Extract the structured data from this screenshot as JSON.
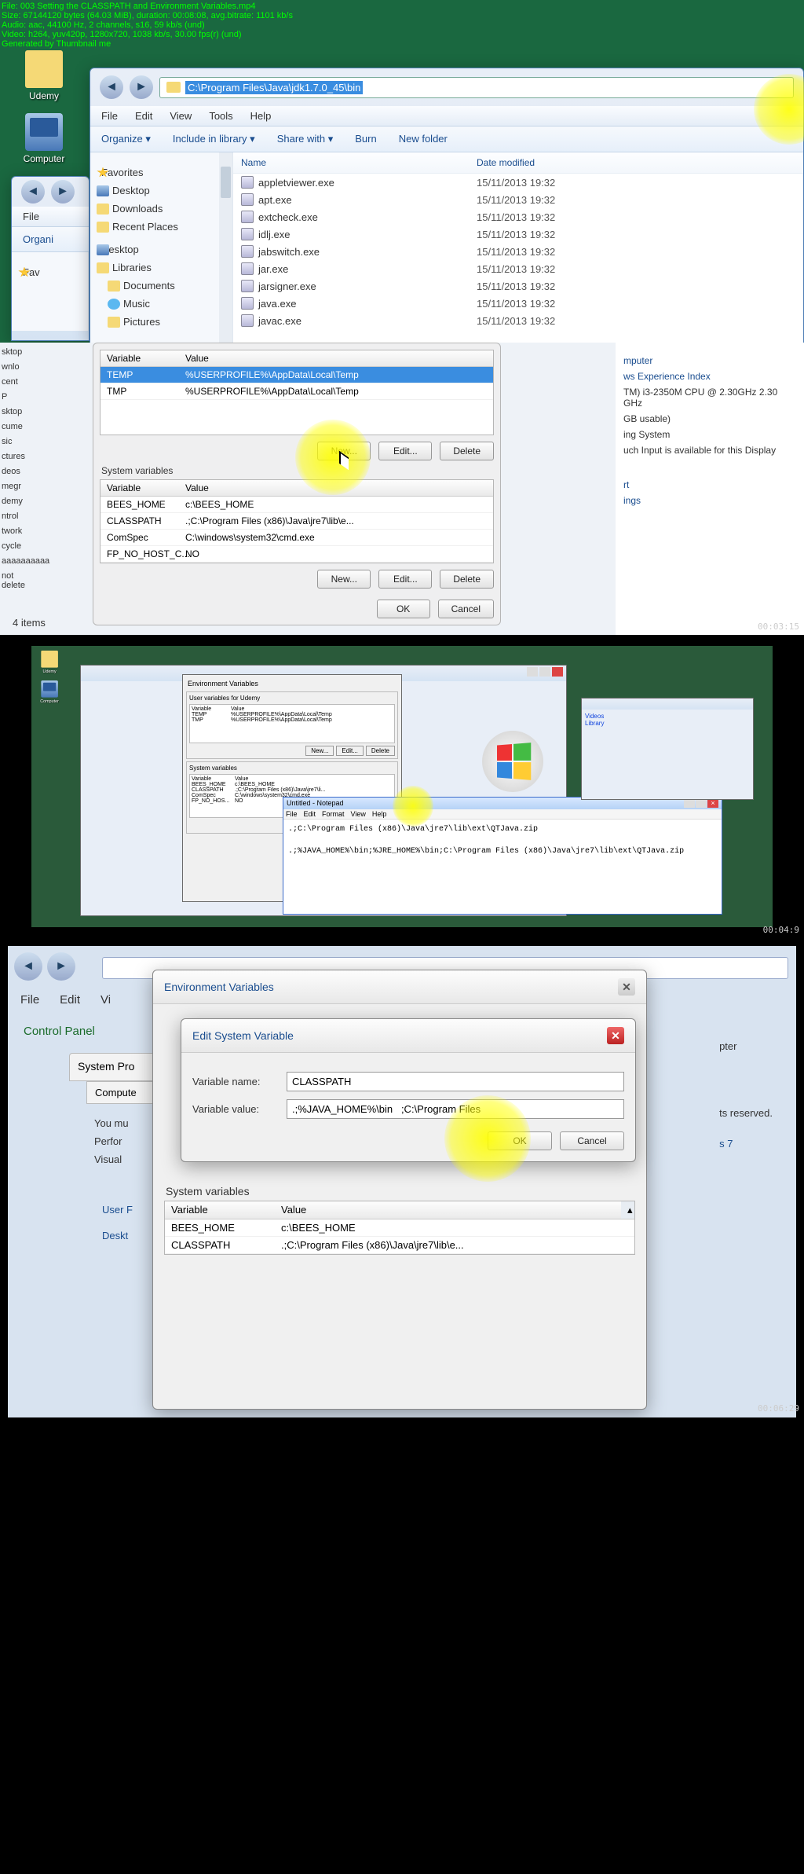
{
  "meta": {
    "l1": "File: 003 Setting the CLASSPATH and Environment Variables.mp4",
    "l2": "Size: 67144120 bytes (64.03 MiB), duration: 00:08:08, avg.bitrate: 1101 kb/s",
    "l3": "Audio: aac, 44100 Hz, 2 channels, s16, 59 kb/s (und)",
    "l4": "Video: h264, yuv420p, 1280x720, 1038 kb/s, 30.00 fps(r) (und)",
    "l5": "Generated by Thumbnail me"
  },
  "ts": {
    "s1": "00:03:15",
    "s2": "00:04:9",
    "s3": "00:06:29"
  },
  "desktop": {
    "udemy": "Udemy",
    "computer": "Computer"
  },
  "explorer": {
    "address": "C:\\Program Files\\Java\\jdk1.7.0_45\\bin",
    "menu": [
      "File",
      "Edit",
      "View",
      "Tools",
      "Help"
    ],
    "toolbar": [
      "Organize ▾",
      "Include in library ▾",
      "Share with ▾",
      "Burn",
      "New folder"
    ],
    "side": {
      "fav": "Favorites",
      "desk": "Desktop",
      "dl": "Downloads",
      "rp": "Recent Places",
      "desk2": "Desktop",
      "lib": "Libraries",
      "docs": "Documents",
      "mus": "Music",
      "pic": "Pictures"
    },
    "cols": {
      "name": "Name",
      "date": "Date modified"
    },
    "files": [
      {
        "n": "appletviewer.exe",
        "d": "15/11/2013 19:32"
      },
      {
        "n": "apt.exe",
        "d": "15/11/2013 19:32"
      },
      {
        "n": "extcheck.exe",
        "d": "15/11/2013 19:32"
      },
      {
        "n": "idlj.exe",
        "d": "15/11/2013 19:32"
      },
      {
        "n": "jabswitch.exe",
        "d": "15/11/2013 19:32"
      },
      {
        "n": "jar.exe",
        "d": "15/11/2013 19:32"
      },
      {
        "n": "jarsigner.exe",
        "d": "15/11/2013 19:32"
      },
      {
        "n": "java.exe",
        "d": "15/11/2013 19:32"
      },
      {
        "n": "javac.exe",
        "d": "15/11/2013 19:32"
      }
    ]
  },
  "s1side": [
    "sktop",
    "wnlo",
    "cent",
    "P",
    "sktop",
    "cume",
    "sic",
    "ctures",
    "deos",
    "megr",
    "demy",
    "ntrol",
    "twork",
    "cycle",
    "aaaaaaaaaa",
    "not delete"
  ],
  "s1status": "4 items",
  "envUser": {
    "cols": {
      "v": "Variable",
      "val": "Value"
    },
    "rows": [
      {
        "v": "TEMP",
        "val": "%USERPROFILE%\\AppData\\Local\\Temp"
      },
      {
        "v": "TMP",
        "val": "%USERPROFILE%\\AppData\\Local\\Temp"
      }
    ]
  },
  "envSys": {
    "label": "System variables",
    "cols": {
      "v": "Variable",
      "val": "Value"
    },
    "rows": [
      {
        "v": "BEES_HOME",
        "val": "c:\\BEES_HOME"
      },
      {
        "v": "CLASSPATH",
        "val": ".;C:\\Program Files (x86)\\Java\\jre7\\lib\\e..."
      },
      {
        "v": "ComSpec",
        "val": "C:\\windows\\system32\\cmd.exe"
      },
      {
        "v": "FP_NO_HOST_C...",
        "val": "NO"
      }
    ]
  },
  "btn": {
    "new": "New...",
    "edit": "Edit...",
    "del": "Delete",
    "ok": "OK",
    "cancel": "Cancel"
  },
  "sysinfo": {
    "a": "mputer",
    "b": "ws Experience Index",
    "c": "TM) i3-2350M CPU @ 2.30GHz   2.30 GHz",
    "d": "GB usable)",
    "e": "ing System",
    "f": "uch Input is available for this Display",
    "g": "rt",
    "h": "ings"
  },
  "s2": {
    "envtitle": "Environment Variables",
    "userlbl": "User variables for Udemy",
    "np_title": "Untitled - Notepad",
    "np_menu": [
      "File",
      "Edit",
      "Format",
      "View",
      "Help"
    ],
    "np_text": ".;C:\\Program Files (x86)\\Java\\jre7\\lib\\ext\\QTJava.zip\n\n.;%JAVA_HOME%\\bin;%JRE_HOME%\\bin;C:\\Program Files (x86)\\Java\\jre7\\lib\\ext\\QTJava.zip"
  },
  "s3": {
    "menu": [
      "File",
      "Edit",
      "Vi"
    ],
    "cp": "Control Panel",
    "sp": "System Pro",
    "comp": "Compute",
    "info": [
      "You mu",
      "Perfor",
      "Visual"
    ],
    "rinfo": [
      "pter",
      "ts reserved.",
      "s 7"
    ],
    "env_title": "Environment Variables",
    "edit_title": "Edit System Variable",
    "vname_lbl": "Variable name:",
    "vname": "CLASSPATH",
    "vval_lbl": "Variable value:",
    "vval": ".;%JAVA_HOME%\\bin   ;C:\\Program Files",
    "sys_lbl": "System variables",
    "userf": "User F",
    "deskt": "Deskt",
    "cols": {
      "v": "Variable",
      "val": "Value"
    },
    "rows": [
      {
        "v": "BEES_HOME",
        "val": "c:\\BEES_HOME"
      },
      {
        "v": "CLASSPATH",
        "val": ".;C:\\Program Files (x86)\\Java\\jre7\\lib\\e..."
      }
    ]
  }
}
